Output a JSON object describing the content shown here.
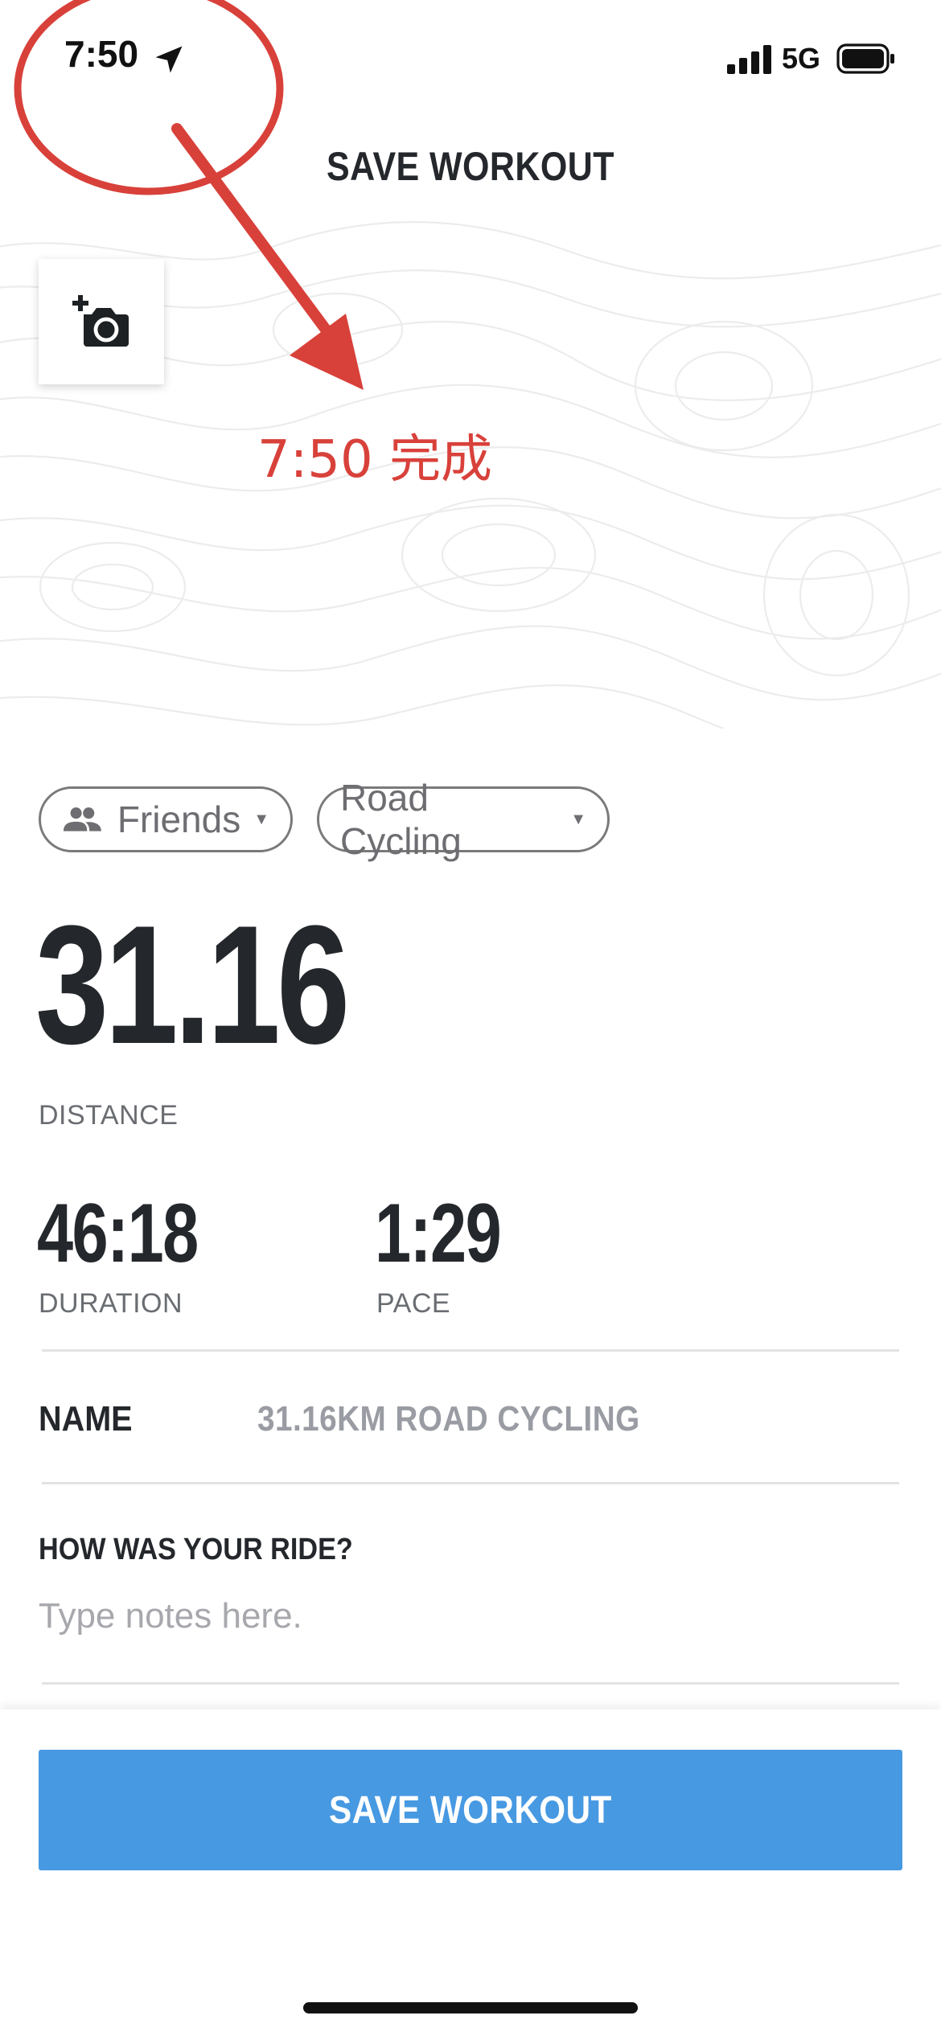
{
  "status_bar": {
    "time": "7:50",
    "network": "5G"
  },
  "header": {
    "title": "SAVE WORKOUT"
  },
  "annotation": {
    "text": "7:50 完成"
  },
  "filters": {
    "privacy": "Friends",
    "activity_type": "Road Cycling"
  },
  "stats": {
    "distance_value": "31.16",
    "distance_label": "DISTANCE",
    "duration_value": "46:18",
    "duration_label": "DURATION",
    "pace_value": "1:29",
    "pace_label": "PACE"
  },
  "name_row": {
    "label": "NAME",
    "value": "31.16KM ROAD CYCLING"
  },
  "notes": {
    "heading": "HOW WAS YOUR RIDE?",
    "placeholder": "Type notes here."
  },
  "footer": {
    "save_label": "SAVE WORKOUT"
  },
  "colors": {
    "accent": "#4799e2",
    "annotation": "#d8413a",
    "text": "#24272b"
  },
  "icons": [
    "location-arrow-icon",
    "signal-icon",
    "battery-icon",
    "add-photo-icon",
    "people-icon",
    "caret-down-icon"
  ]
}
